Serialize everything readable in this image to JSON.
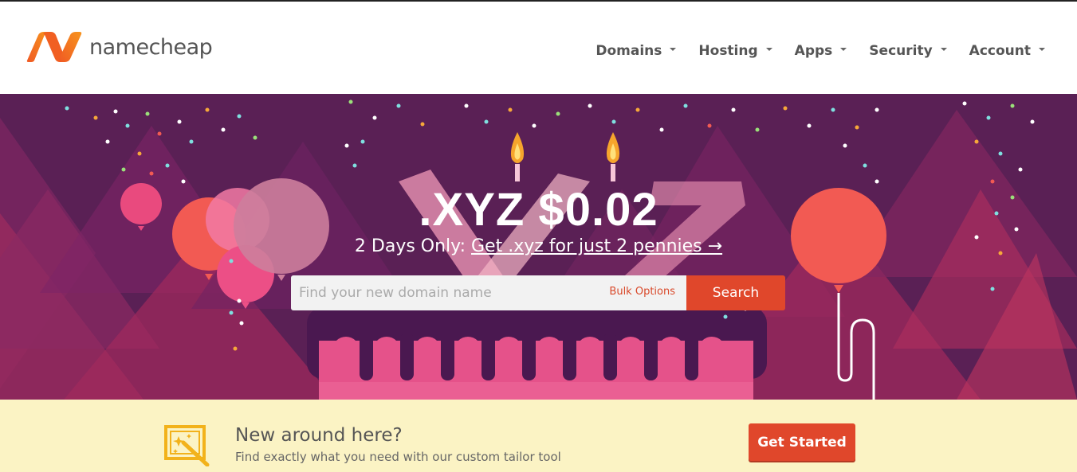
{
  "brand": {
    "name": "namecheap",
    "accent": "#f26522",
    "primary_button": "#e0472b"
  },
  "nav": {
    "items": [
      {
        "label": "Domains"
      },
      {
        "label": "Hosting"
      },
      {
        "label": "Apps"
      },
      {
        "label": "Security"
      },
      {
        "label": "Account"
      }
    ]
  },
  "hero": {
    "title": ".XYZ $0.02",
    "subtitle_prefix": "2 Days Only: ",
    "subtitle_link": "Get .xyz for just 2 pennies →",
    "background_colors": {
      "deep": "#5a2055",
      "magenta": "#a3275f",
      "pink": "#e8547a"
    }
  },
  "search": {
    "placeholder": "Find your new domain name",
    "value": "",
    "bulk_label": "Bulk Options",
    "button_label": "Search"
  },
  "promo": {
    "title": "New around here?",
    "subtitle": "Find exactly what you need with our custom tailor tool",
    "button_label": "Get Started",
    "icon": "magic-wand-icon",
    "background": "#fbf3c4"
  }
}
